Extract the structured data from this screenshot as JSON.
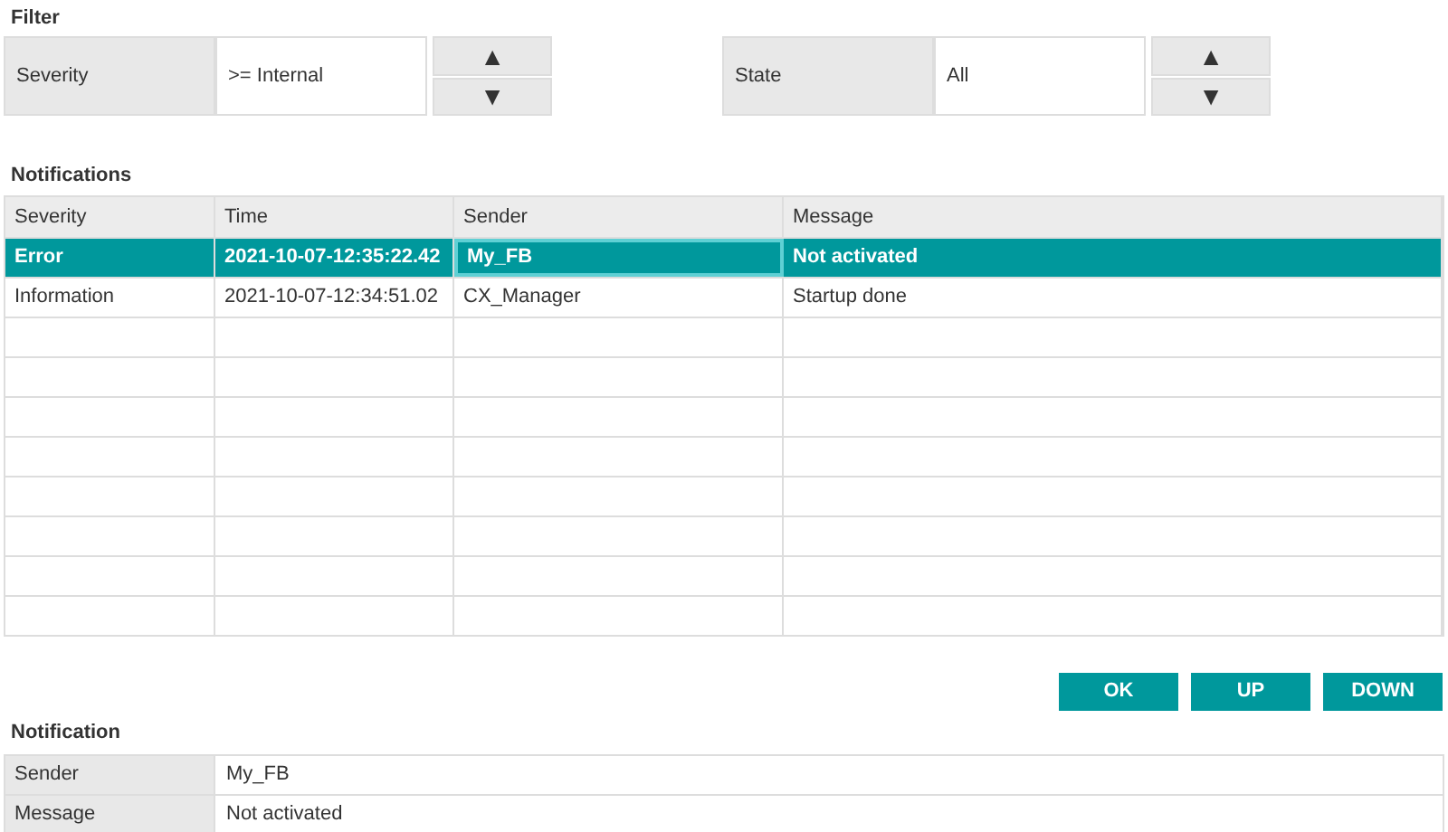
{
  "filter": {
    "title": "Filter",
    "fields": [
      {
        "label": "Severity",
        "value": ">= Internal",
        "up": "▲",
        "down": "▼"
      },
      {
        "label": "State",
        "value": "All",
        "up": "▲",
        "down": "▼"
      }
    ]
  },
  "notifications": {
    "title": "Notifications",
    "columns": [
      "Severity",
      "Time",
      "Sender",
      "Message"
    ],
    "rows": [
      {
        "selected": true,
        "cells": [
          {
            "text": "Error",
            "focused": false
          },
          {
            "text": "2021-10-07-12:35:22.42",
            "focused": false
          },
          {
            "text": "My_FB",
            "focused": true
          },
          {
            "text": "Not activated",
            "focused": false
          }
        ]
      },
      {
        "selected": false,
        "cells": [
          {
            "text": "Information",
            "focused": false
          },
          {
            "text": "2021-10-07-12:34:51.02",
            "focused": false
          },
          {
            "text": "CX_Manager",
            "focused": false
          },
          {
            "text": "Startup done",
            "focused": false
          }
        ]
      }
    ]
  },
  "buttons": [
    "OK",
    "UP",
    "DOWN"
  ],
  "notification": {
    "title": "Notification",
    "fields": [
      {
        "label": "Sender",
        "value": "My_FB"
      },
      {
        "label": "Message",
        "value": "Not activated"
      }
    ]
  }
}
